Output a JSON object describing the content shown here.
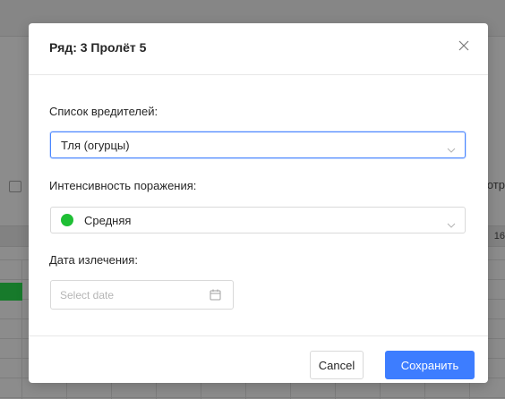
{
  "background": {
    "right_text": "отр",
    "right_number": "16",
    "accent_green": "#177a2b"
  },
  "modal": {
    "title": "Ряд: 3 Пролёт 5",
    "close_icon": "close-icon",
    "fields": {
      "pests": {
        "label": "Список вредителей:",
        "value": "Тля (огурцы)"
      },
      "intensity": {
        "label": "Интенсивность поражения:",
        "value": "Средняя",
        "indicator_color": "#1fbf35"
      },
      "extraction_date": {
        "label": "Дата излечения:",
        "placeholder": "Select date",
        "icon": "calendar-icon"
      }
    },
    "footer": {
      "cancel_label": "Cancel",
      "save_label": "Сохранить",
      "save_color": "#3d7dff"
    }
  }
}
